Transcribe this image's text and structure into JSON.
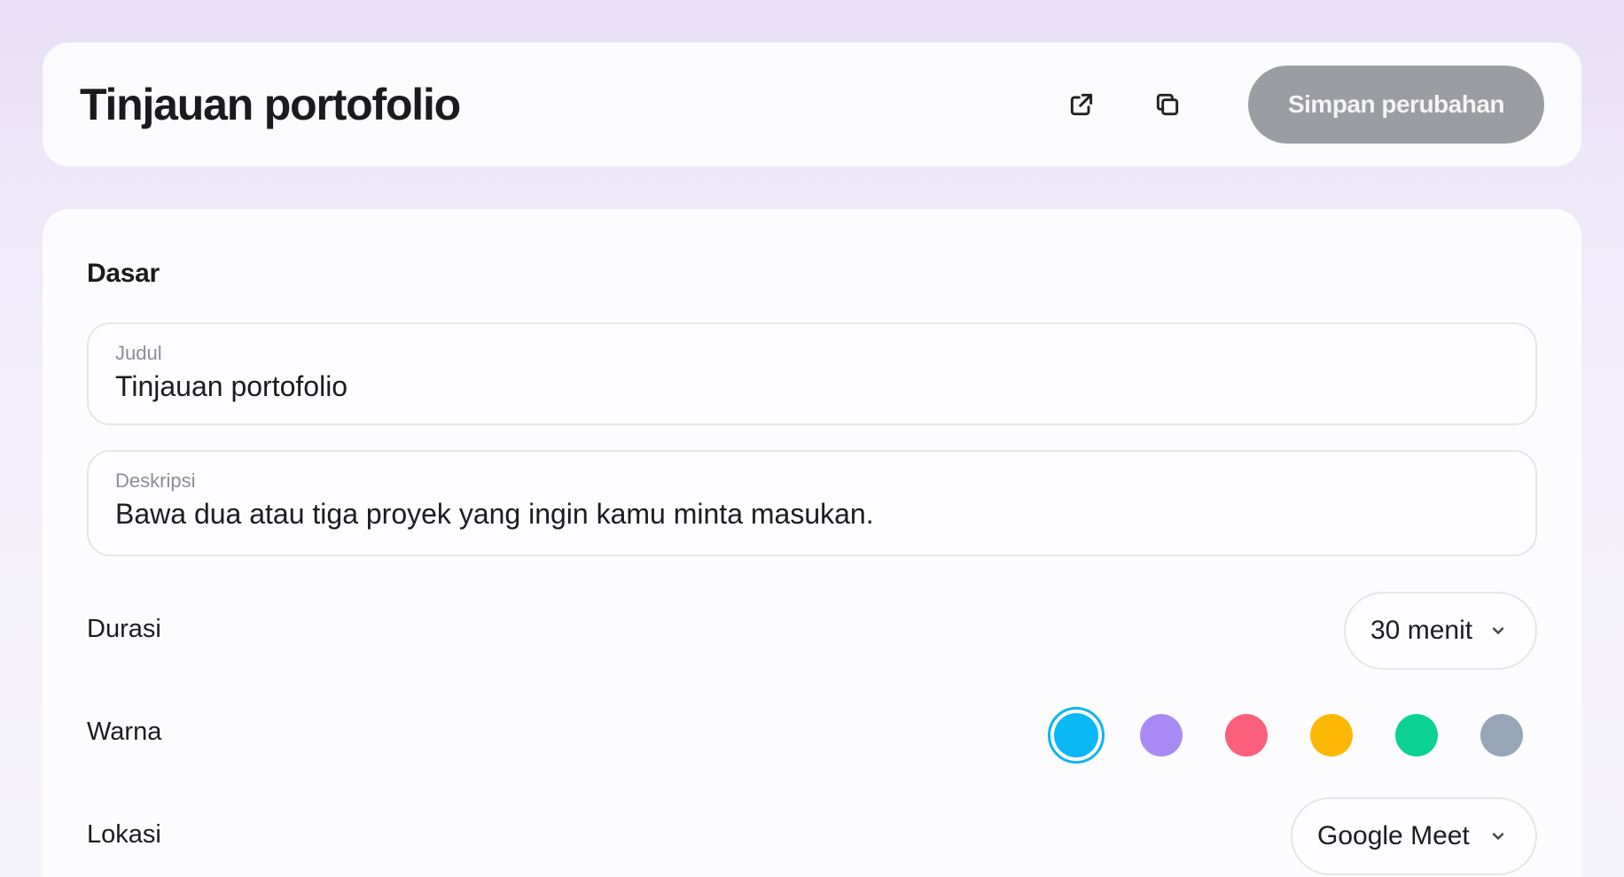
{
  "header": {
    "title": "Tinjauan portofolio",
    "open_icon": "external-link-icon",
    "copy_icon": "copy-icon",
    "save_label": "Simpan perubahan"
  },
  "basic": {
    "section_title": "Dasar",
    "title_field": {
      "label": "Judul",
      "value": "Tinjauan portofolio"
    },
    "description_field": {
      "label": "Deskripsi",
      "value": "Bawa dua atau tiga proyek yang ingin kamu minta masukan."
    }
  },
  "duration": {
    "label": "Durasi",
    "value": "30 menit"
  },
  "color": {
    "label": "Warna",
    "selected": "#0ab8f5",
    "options": [
      "#0ab8f5",
      "#a98af5",
      "#fb5f79",
      "#fdb705",
      "#0bd293",
      "#97a5b8"
    ]
  },
  "location": {
    "label": "Lokasi",
    "value": "Google Meet"
  },
  "colors": {
    "save_bg": "#9c9ca3",
    "accent_ring": "#0fb4ee"
  }
}
